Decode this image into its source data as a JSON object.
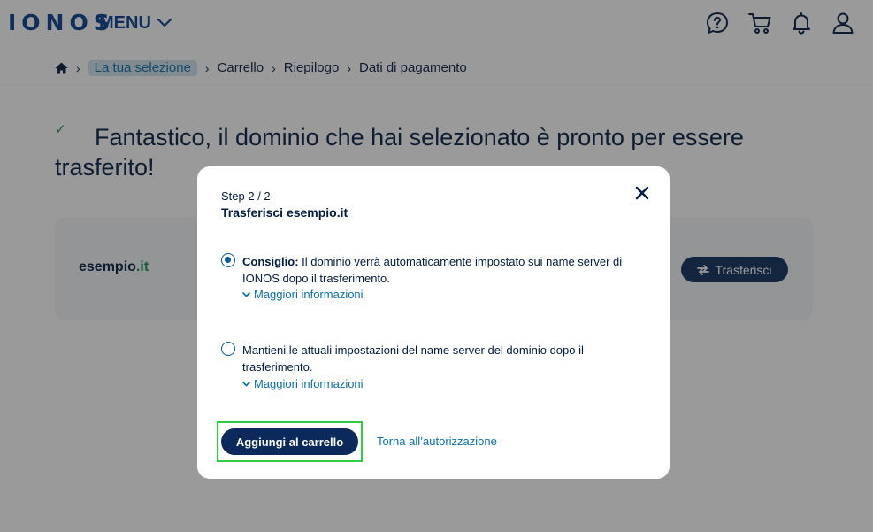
{
  "header": {
    "logo": "IONOS",
    "menu_label": "MENU",
    "icons": [
      "help-chat-icon",
      "cart-icon",
      "bell-icon",
      "user-icon"
    ]
  },
  "breadcrumb": {
    "items": [
      "La tua selezione",
      "Carrello",
      "Riepilogo",
      "Dati di pagamento"
    ]
  },
  "main": {
    "headline": "Fantastico, il dominio che hai selezionato è pronto per essere trasferito!",
    "check": "✓",
    "domain_base": "esempio",
    "domain_tld": ".it",
    "transfer_label": "Trasferisci"
  },
  "modal": {
    "step": "Step 2 / 2",
    "title": "Trasferisci esempio.it",
    "option1_bold": "Consiglio:",
    "option1_text": " Il dominio verrà automaticamente impostato sui name server di IONOS dopo il trasferimento.",
    "option2_text": "Mantieni le attuali impostazioni del name server del dominio dopo il trasferimento.",
    "more_info": "Maggiori informazioni",
    "cta": "Aggiungi al carrello",
    "back": "Torna all’autorizzazione"
  },
  "colors": {
    "brand": "#003d8f",
    "primary_button": "#0b2a5b",
    "link": "#0b6ea6",
    "success": "#1a8a4a",
    "highlight": "#2ecc40"
  }
}
